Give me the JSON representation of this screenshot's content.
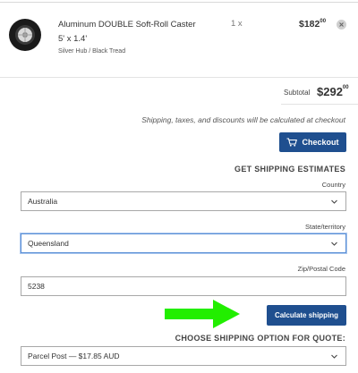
{
  "cart": {
    "item": {
      "title": "Aluminum DOUBLE Soft-Roll Caster 5' x 1.4'",
      "variant": "Silver Hub / Black Tread",
      "quantity": "1 x",
      "price_main": "$182",
      "price_cents": "00",
      "image_icon": "caster-wheel-icon",
      "remove_icon": "close-icon"
    },
    "subtotal_label": "Subtotal",
    "subtotal_main": "$292",
    "subtotal_cents": "00",
    "shipping_note": "Shipping, taxes, and discounts will be calculated at checkout",
    "checkout_label": "Checkout",
    "checkout_icon": "cart-icon"
  },
  "shipping": {
    "heading": "GET SHIPPING ESTIMATES",
    "country_label": "Country",
    "country_value": "Australia",
    "state_label": "State/territory",
    "state_value": "Queensland",
    "zip_label": "Zip/Postal Code",
    "zip_value": "5238",
    "calculate_label": "Calculate shipping",
    "choose_heading": "CHOOSE SHIPPING OPTION FOR QUOTE:",
    "option_value": "Parcel Post — $17.85 AUD"
  },
  "colors": {
    "button_bg": "#1f4f8f",
    "annotation_arrow": "#22ee00",
    "focus_border": "#5a8fd6"
  }
}
